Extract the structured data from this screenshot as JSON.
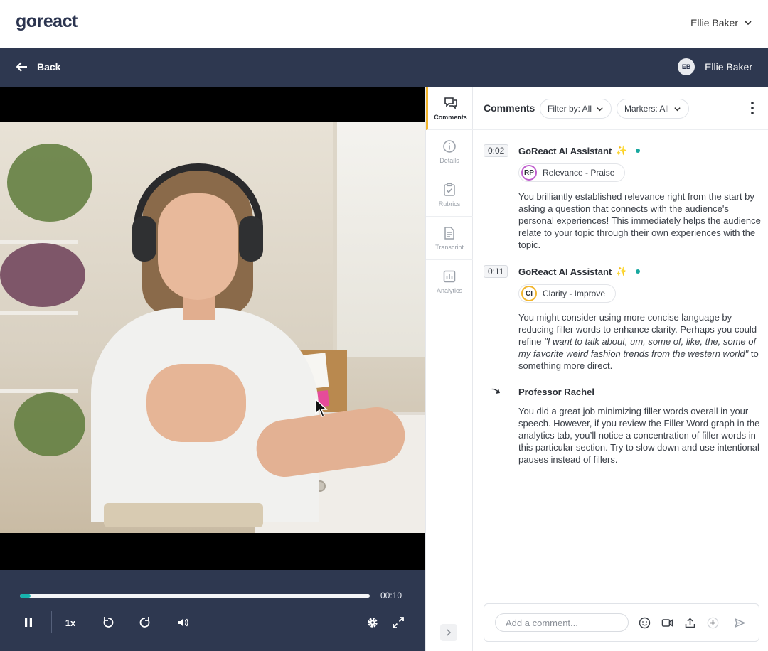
{
  "app": {
    "logo": "goreact",
    "top_user": "Ellie Baker"
  },
  "nav": {
    "back_label": "Back",
    "user_initials": "EB",
    "user_name": "Ellie Baker"
  },
  "player": {
    "time": "00:10",
    "progress_fraction": 0.03,
    "speed_label": "1x",
    "progress_color": "#17b3ad"
  },
  "rail": {
    "tabs": [
      {
        "label": "Comments",
        "icon": "comments-icon",
        "active": true
      },
      {
        "label": "Details",
        "icon": "info-icon",
        "active": false
      },
      {
        "label": "Rubrics",
        "icon": "rubric-icon",
        "active": false
      },
      {
        "label": "Transcript",
        "icon": "transcript-icon",
        "active": false
      },
      {
        "label": "Analytics",
        "icon": "analytics-icon",
        "active": false
      }
    ]
  },
  "comments": {
    "title": "Comments",
    "filter_label": "Filter by: All",
    "markers_label": "Markers: All",
    "items": [
      {
        "timestamp": "0:02",
        "author": "GoReact AI Assistant",
        "marker_abbr": "RP",
        "marker_label": "Relevance - Praise",
        "marker_color": "#c05fce",
        "text": "You brilliantly established relevance right from the start by asking a question that connects with the audience's personal experiences! This immediately helps the audience relate to your topic through their own experiences with the topic."
      },
      {
        "timestamp": "0:11",
        "author": "GoReact AI Assistant",
        "marker_abbr": "CI",
        "marker_label": "Clarity - Improve",
        "marker_color": "#f2b62e",
        "text_before": "You might consider using more concise language by reducing filler words to enhance clarity. Perhaps you could refine ",
        "text_quote": "\"I want to talk about, um, some of, like, the, some of my favorite weird fashion trends from the western world\"",
        "text_after": " to something more direct."
      }
    ],
    "reply": {
      "author": "Professor Rachel",
      "text": "You did a great job minimizing filler words overall in your speech. However, if you review the Filler Word graph in the analytics tab, you’ll notice a concentration of filler words in this particular section. Try to slow down and use intentional pauses instead of fillers."
    },
    "composer_placeholder": "Add a comment..."
  }
}
